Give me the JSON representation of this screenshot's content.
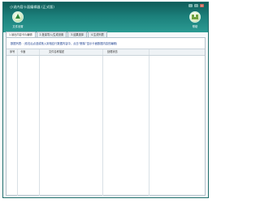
{
  "window": {
    "title": "小说内容卡面编辑器 (正式版)",
    "controls": [
      "-",
      "□",
      "x"
    ]
  },
  "toolbar": {
    "left_button": {
      "label": "文件设置",
      "icon": "leaf-arrow-icon"
    },
    "right_button": {
      "label": "帮助",
      "icon": "cart-icon"
    }
  },
  "tabs": [
    {
      "label": "1.读出内容卡片编辑",
      "active": true
    },
    {
      "label": "2.批量导入/生成设置",
      "active": false
    },
    {
      "label": "3.结果选择",
      "active": false
    },
    {
      "label": "4.生成列表",
      "active": false
    }
  ],
  "main": {
    "note": "数据列表：(双击后点选或拖入到相应行数据内容中，点击“删除”显示卡面数据内容的编辑)",
    "columns": [
      "序号",
      "卡面",
      "文件名称描述",
      "处理状态"
    ],
    "rows": []
  },
  "colors": {
    "titlebar": "#1b7f7a",
    "note_text": "#1b3f8f",
    "panel_border": "#b3c1cb"
  }
}
